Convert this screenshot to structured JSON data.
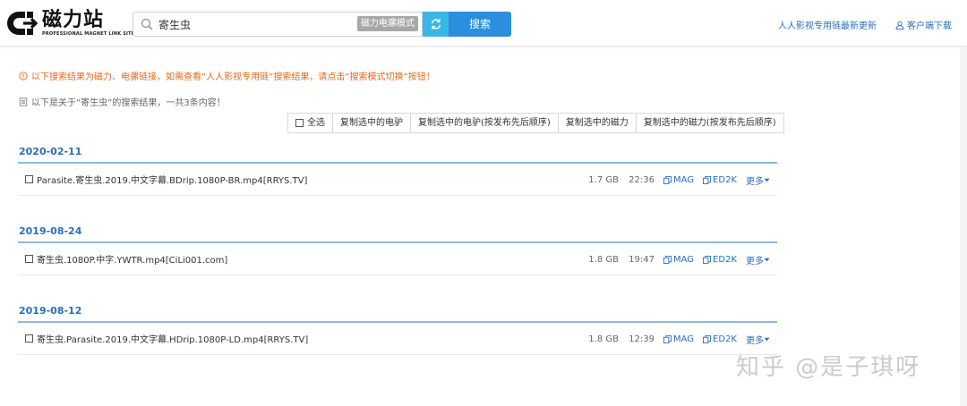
{
  "logo": {
    "name": "磁力站",
    "subtitle": "PROFESSIONAL MAGNET LINK SITE"
  },
  "search": {
    "value": "寄生虫",
    "mode_badge": "磁力电骡模式",
    "button": "搜索"
  },
  "header_links": {
    "update": "人人影视专用链最新更新",
    "client": "客户端下载"
  },
  "notice": "以下搜索结果为磁力、电骡链接，如需查看“人人影视专用链”搜索结果，请点击“搜索模式切换”按钮！",
  "summary": "以下是关于“寄生虫”的搜索结果，一共3条内容！",
  "toolbar": {
    "select_all": "全选",
    "copy_ed2k": "复制选中的电驴",
    "copy_ed2k_sorted": "复制选中的电驴(按发布先后顺序)",
    "copy_magnet": "复制选中的磁力",
    "copy_magnet_sorted": "复制选中的磁力(按发布先后顺序)"
  },
  "results": [
    {
      "date": "2020-02-11",
      "name": "Parasite.寄生虫.2019.中文字幕.BDrip.1080P-BR.mp4[RRYS.TV]",
      "size": "1.7 GB",
      "time": "22:36",
      "mag": "MAG",
      "ed2k": "ED2K",
      "more": "更多"
    },
    {
      "date": "2019-08-24",
      "name": "寄生虫.1080P.中字.YWTR.mp4[CiLi001.com]",
      "size": "1.8 GB",
      "time": "19:47",
      "mag": "MAG",
      "ed2k": "ED2K",
      "more": "更多"
    },
    {
      "date": "2019-08-12",
      "name": "寄生虫.Parasite.2019.中文字幕.HDrip.1080P-LD.mp4[RRYS.TV]",
      "size": "1.8 GB",
      "time": "12:39",
      "mag": "MAG",
      "ed2k": "ED2K",
      "more": "更多"
    }
  ],
  "watermark": "知乎 @是子琪呀"
}
